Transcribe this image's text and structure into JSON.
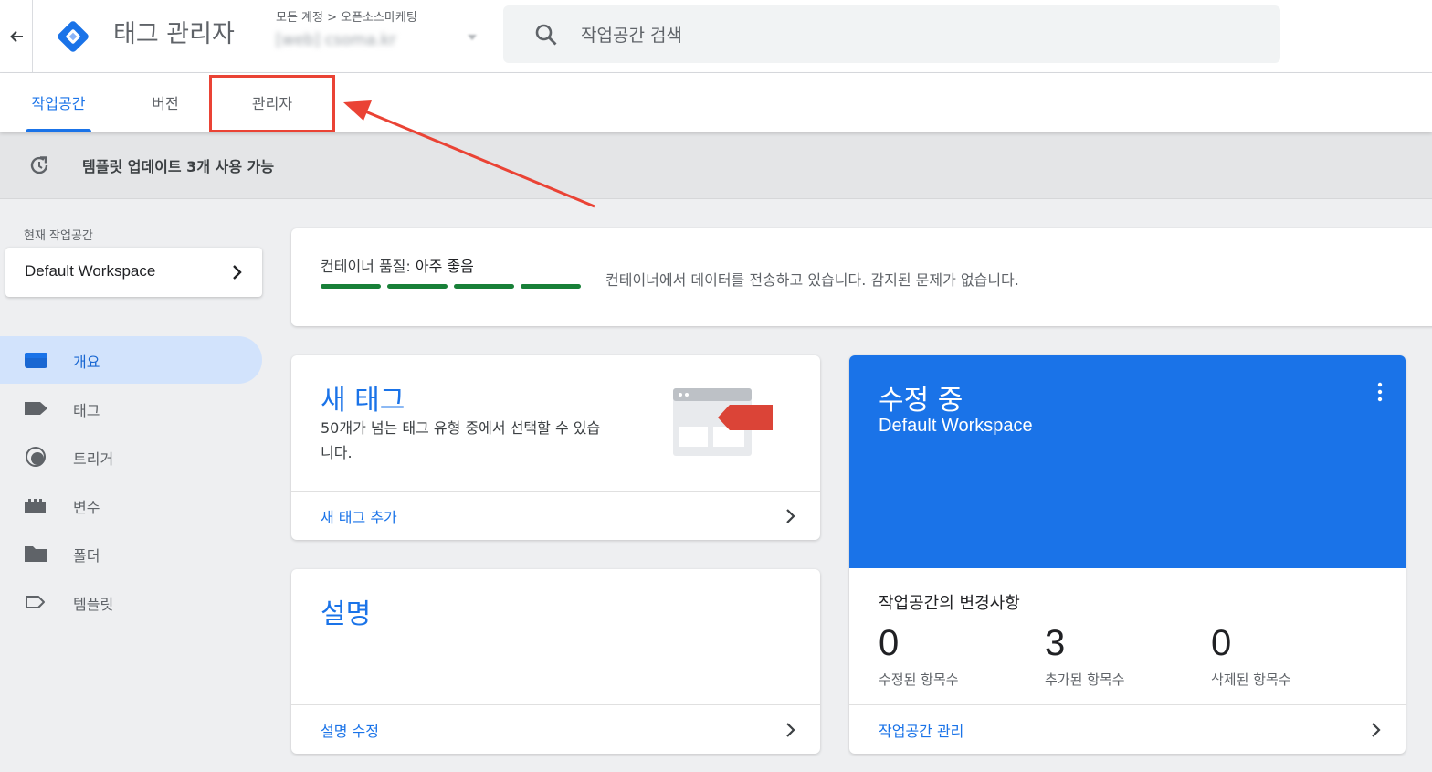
{
  "header": {
    "app_title": "태그 관리자",
    "breadcrumb": "모든 계정 > 오픈소스마케팅",
    "container_name": "[web] csoma.kr",
    "search_placeholder": "작업공간 검색"
  },
  "tabs": [
    {
      "label": "작업공간",
      "active": true
    },
    {
      "label": "버전",
      "active": false
    },
    {
      "label": "관리자",
      "active": false
    }
  ],
  "banner": {
    "text": "템플릿 업데이트 3개 사용 가능"
  },
  "sidebar": {
    "workspace_label": "현재 작업공간",
    "workspace_name": "Default Workspace",
    "nav": [
      {
        "label": "개요",
        "icon": "overview-icon",
        "active": true
      },
      {
        "label": "태그",
        "icon": "tag-icon",
        "active": false
      },
      {
        "label": "트리거",
        "icon": "trigger-icon",
        "active": false
      },
      {
        "label": "변수",
        "icon": "variable-icon",
        "active": false
      },
      {
        "label": "폴더",
        "icon": "folder-icon",
        "active": false
      },
      {
        "label": "템플릿",
        "icon": "template-icon",
        "active": false
      }
    ]
  },
  "quality": {
    "label": "컨테이너 품질:",
    "value": "아주 좋음",
    "bar_count": 4,
    "bar_color": "#188038",
    "message": "컨테이너에서 데이터를 전송하고 있습니다. 감지된 문제가 없습니다."
  },
  "new_tag": {
    "title": "새 태그",
    "description": "50개가 넘는 태그 유형 중에서 선택할 수 있습니다.",
    "link": "새 태그 추가"
  },
  "description_card": {
    "title": "설명",
    "link": "설명 수정"
  },
  "workspace_card": {
    "title": "수정 중",
    "name": "Default Workspace",
    "changes_title": "작업공간의 변경사항",
    "stats": [
      {
        "value": "0",
        "label": "수정된 항목수"
      },
      {
        "value": "3",
        "label": "추가된 항목수"
      },
      {
        "value": "0",
        "label": "삭제된 항목수"
      }
    ],
    "link": "작업공간 관리"
  },
  "colors": {
    "accent": "#1a73e8",
    "annotation": "#ea4335"
  }
}
